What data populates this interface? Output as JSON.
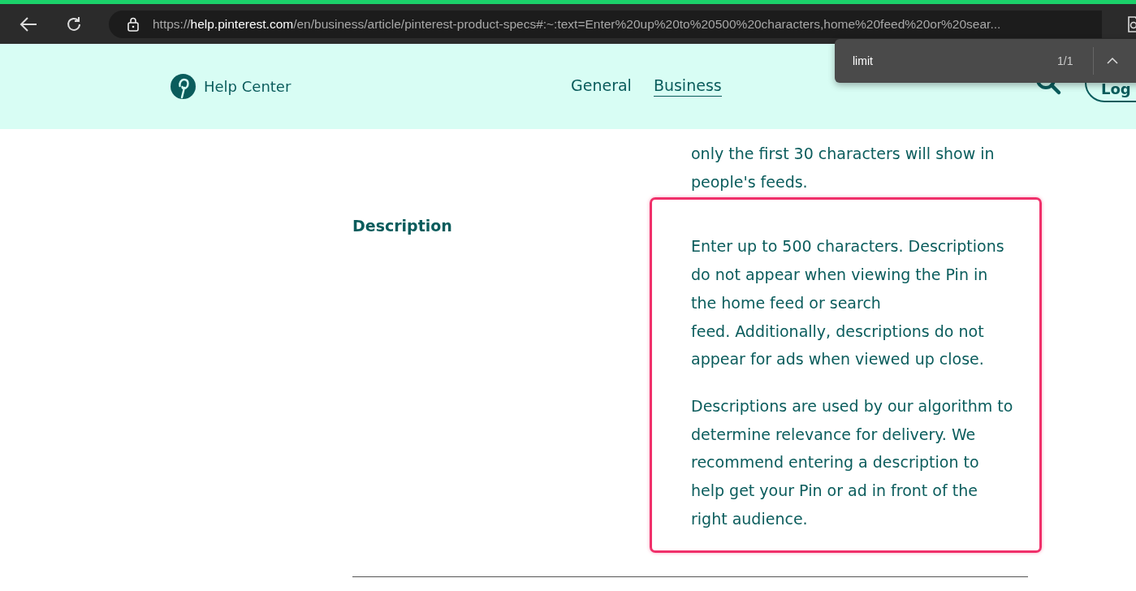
{
  "browser": {
    "url_scheme": "https://",
    "url_host": "help.pinterest.com",
    "url_path": "/en/business/article/pinterest-product-specs#:~:text=Enter%20up%20to%20500%20characters,home%20feed%20or%20sear..."
  },
  "find_bar": {
    "value": "limit",
    "count": "1/1"
  },
  "header": {
    "brand": "Help Center",
    "nav": [
      {
        "label": "General",
        "selected": false
      },
      {
        "label": "Business",
        "selected": true
      }
    ],
    "login": "Log"
  },
  "rows": [
    {
      "label": "",
      "highlighted": false,
      "paragraphs": [
        {
          "lines": [
            "only the first 30 characters will show in",
            "people's feeds."
          ]
        }
      ]
    },
    {
      "label": "Description",
      "highlighted": true,
      "paragraphs": [
        {
          "lines": [
            "Enter up to 500 characters. Descriptions do not appear when viewing the Pin in the home feed or search",
            "feed. Additionally, descriptions do not appear for ads when viewed up close."
          ]
        },
        {
          "lines": [
            "Descriptions are used by our algorithm to determine relevance for delivery. We recommend entering a description to help get your Pin or ad in front of the right audience."
          ]
        }
      ]
    }
  ]
}
